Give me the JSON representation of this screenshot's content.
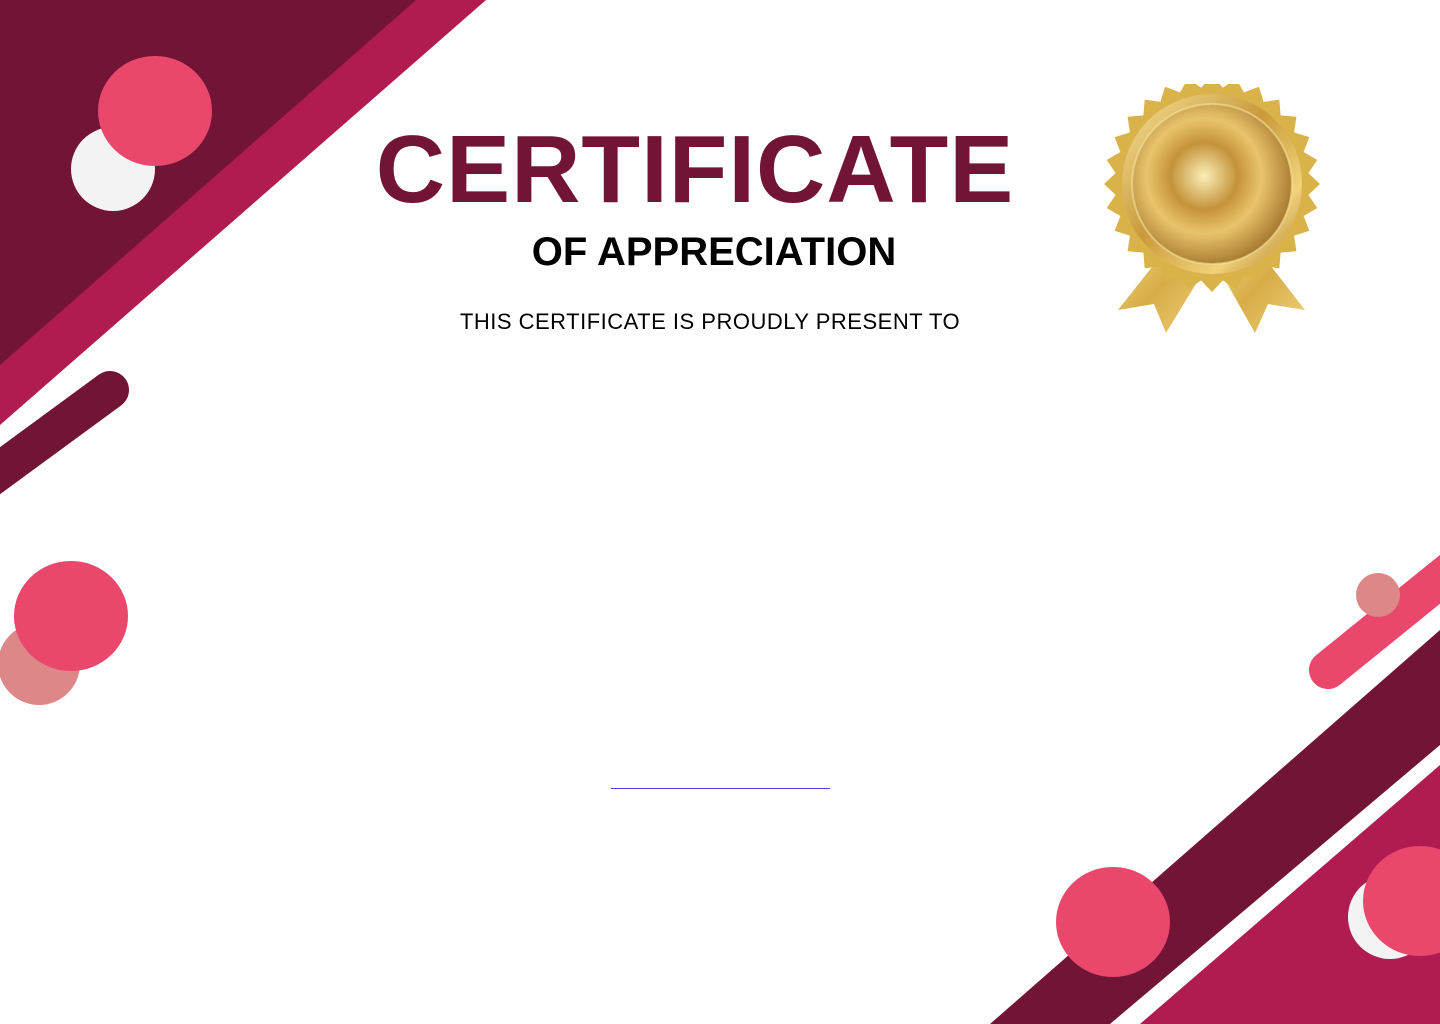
{
  "certificate": {
    "title": "CERTIFICATE",
    "subtitle": "OF APPRECIATION",
    "presented_to_text": "THIS CERTIFICATE IS PROUDLY PRESENT TO",
    "recipient_name": "",
    "signature_line": ""
  },
  "colors": {
    "maroon": "#721436",
    "magenta": "#b01b51",
    "pink": "#ea476d",
    "rose": "#dd8788",
    "off_white": "#f3f3f3",
    "title_text": "#721436",
    "body_text": "#000000",
    "signature_line": "#4a3cf0",
    "gold": "#d9b24a"
  },
  "icons": {
    "medal": "gold-medal-icon"
  }
}
